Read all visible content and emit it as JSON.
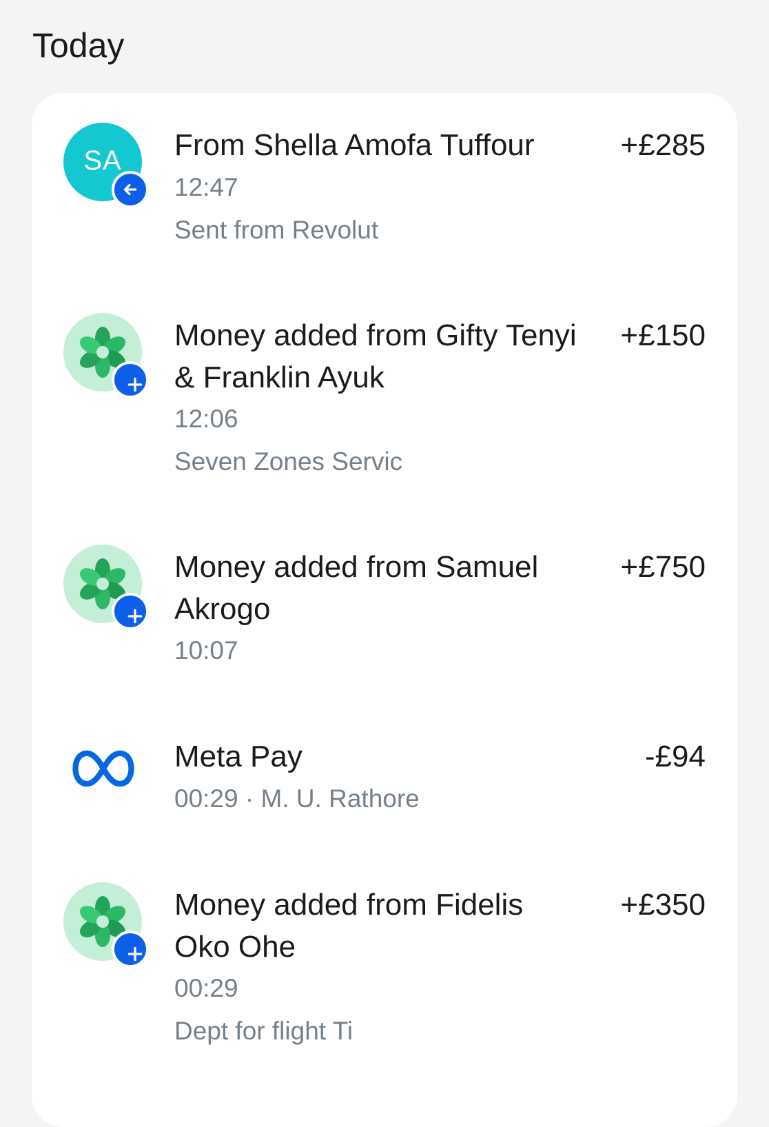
{
  "section": {
    "title": "Today"
  },
  "transactions": [
    {
      "avatar_type": "initials",
      "initials": "SA",
      "avatar_color": "#14c8d2",
      "badge_icon": "arrow-left-icon",
      "title": "From Shella Amofa Tuffour",
      "amount": "+£285",
      "time": "12:47",
      "reference": "Sent from Revolut"
    },
    {
      "avatar_type": "flower",
      "badge_icon": "plus-icon",
      "title": "Money added from Gifty Tenyi & Franklin Ayuk",
      "amount": "+£150",
      "time": "12:06",
      "reference": "Seven Zones Servic"
    },
    {
      "avatar_type": "flower",
      "badge_icon": "plus-icon",
      "title": "Money added from Samuel Akrogo",
      "amount": "+£750",
      "time": "10:07"
    },
    {
      "avatar_type": "meta-logo",
      "title": "Meta Pay",
      "amount": "-£94",
      "time_line": "00:29 · M. U. Rathore"
    },
    {
      "avatar_type": "flower",
      "badge_icon": "plus-icon",
      "title": "Money added from Fidelis Oko Ohe",
      "amount": "+£350",
      "time": "00:29",
      "reference": "Dept for flight Ti"
    }
  ],
  "colors": {
    "badge": "#0d5fe8",
    "flower_bg": "#c4eed6",
    "meta_blue": "#0668e1"
  }
}
